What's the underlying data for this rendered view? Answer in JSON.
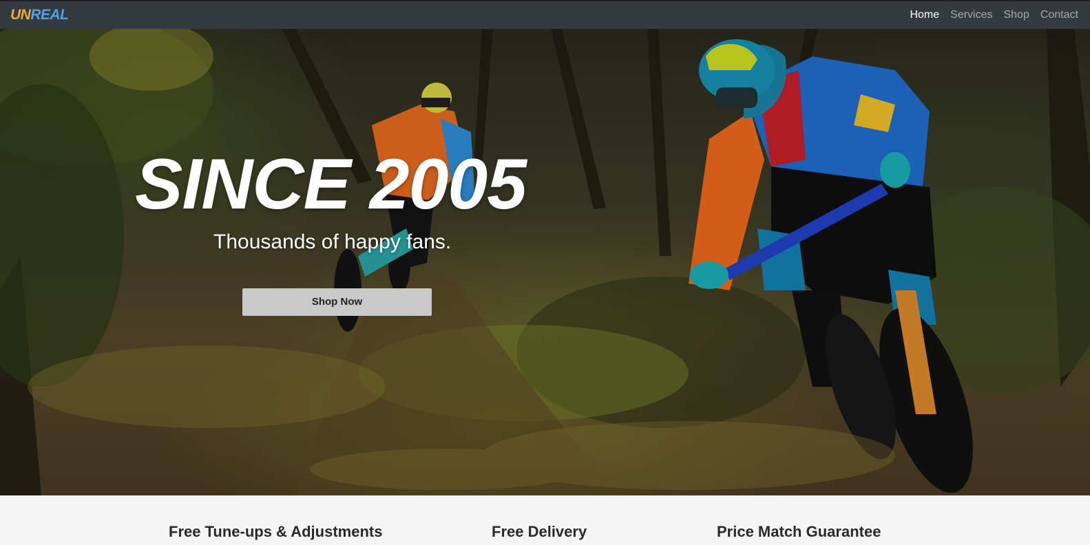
{
  "brand": {
    "part1": "UN",
    "part2": "REAL"
  },
  "nav": {
    "items": [
      {
        "label": "Home",
        "active": true
      },
      {
        "label": "Services",
        "active": false
      },
      {
        "label": "Shop",
        "active": false
      },
      {
        "label": "Contact",
        "active": false
      }
    ]
  },
  "hero": {
    "title": "SINCE 2005",
    "subtitle": "Thousands of happy fans.",
    "button_label": "Shop Now"
  },
  "features": [
    {
      "title": "Free Tune-ups & Adjustments"
    },
    {
      "title": "Free Delivery"
    },
    {
      "title": "Price Match Guarantee"
    }
  ],
  "colors": {
    "navbar_bg": "#343a40",
    "brand_orange": "#f2a93b",
    "brand_blue": "#4ea3e6",
    "button_bg": "#c9c9c9",
    "features_bg": "#f5f5f5"
  }
}
